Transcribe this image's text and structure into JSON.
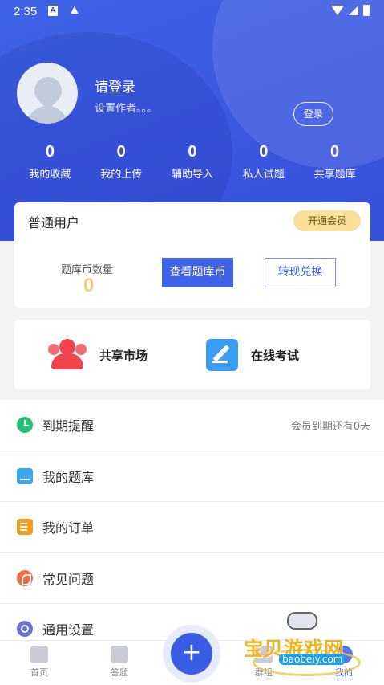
{
  "status_bar": {
    "time": "2:35",
    "notif_a": "A",
    "warning": "▲"
  },
  "profile": {
    "title": "请登录",
    "subtitle": "设置作者。。。",
    "login_button": "登录"
  },
  "stats": [
    {
      "value": "0",
      "label": "我的收藏"
    },
    {
      "value": "0",
      "label": "我的上传"
    },
    {
      "value": "0",
      "label": "辅助导入"
    },
    {
      "value": "0",
      "label": "私人试题"
    },
    {
      "value": "0",
      "label": "共享题库"
    }
  ],
  "member": {
    "type": "普通用户",
    "vip_button": "开通会员",
    "coin_label": "题库币数量",
    "coin_value": "0",
    "check_button": "查看题库币",
    "exchange_button": "转现兑换"
  },
  "features": [
    {
      "label": "共享市场",
      "icon": "people-icon"
    },
    {
      "label": "在线考试",
      "icon": "edit-icon"
    }
  ],
  "menu": [
    {
      "label": "到期提醒",
      "icon": "clock-icon",
      "extra": "会员到期还有0天"
    },
    {
      "label": "我的题库",
      "icon": "question-bank-icon",
      "extra": ""
    },
    {
      "label": "我的订单",
      "icon": "order-icon",
      "extra": ""
    },
    {
      "label": "常见问题",
      "icon": "faq-icon",
      "extra": ""
    },
    {
      "label": "通用设置",
      "icon": "settings-icon",
      "extra": ""
    }
  ],
  "bottom_nav": {
    "items": [
      {
        "label": "首页",
        "icon": "home-icon"
      },
      {
        "label": "答题",
        "icon": "answer-icon"
      },
      {
        "label": "群组",
        "icon": "group-icon"
      },
      {
        "label": "我的",
        "icon": "profile-icon",
        "active": true
      }
    ],
    "fab": "+"
  },
  "watermark": {
    "text": "宝贝游戏网",
    "url": "baobeiy.com"
  },
  "colors": {
    "primary": "#3f63e6",
    "vip": "#fbe097",
    "coin": "#f0cc7c"
  }
}
